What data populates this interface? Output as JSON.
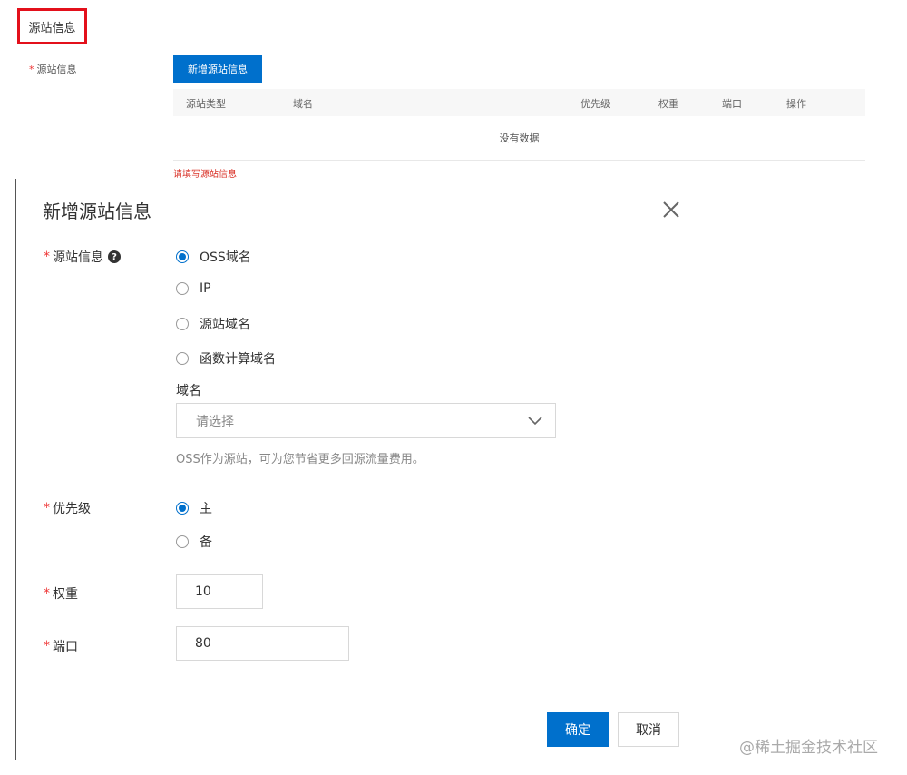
{
  "section": {
    "title": "源站信息"
  },
  "origin_field": {
    "required_mark": "*",
    "label": "源站信息",
    "add_button": "新增源站信息",
    "table": {
      "columns": [
        "源站类型",
        "域名",
        "优先级",
        "权重",
        "端口",
        "操作"
      ],
      "empty_text": "没有数据"
    },
    "error": "请填写源站信息"
  },
  "modal": {
    "title": "新增源站信息",
    "origin": {
      "label": "源站信息",
      "help_icon": "?",
      "options": [
        {
          "label": "OSS域名",
          "checked": true
        },
        {
          "label": "IP",
          "checked": false
        },
        {
          "label": "源站域名",
          "checked": false
        },
        {
          "label": "函数计算域名",
          "checked": false
        }
      ],
      "domain_label": "域名",
      "domain_placeholder": "请选择",
      "hint": "OSS作为源站，可为您节省更多回源流量费用。"
    },
    "priority": {
      "label": "优先级",
      "options": [
        {
          "label": "主",
          "checked": true
        },
        {
          "label": "备",
          "checked": false
        }
      ]
    },
    "weight": {
      "label": "权重",
      "value": "10"
    },
    "port": {
      "label": "端口",
      "value": "80"
    },
    "confirm_button": "确定",
    "cancel_button": "取消"
  },
  "watermark": "@稀土掘金技术社区",
  "colors": {
    "primary": "#0070cc",
    "error": "#e3101b",
    "required": "#e33"
  }
}
